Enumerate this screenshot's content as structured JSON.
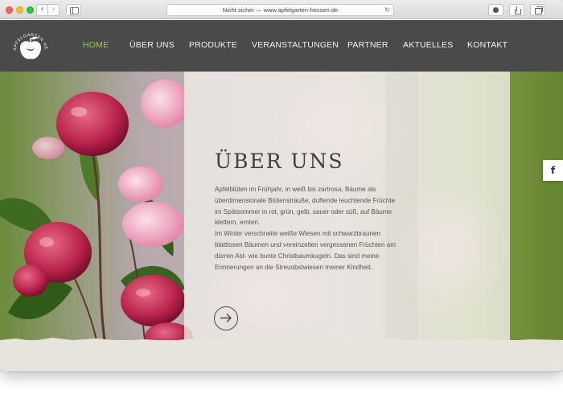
{
  "browser": {
    "address": "Nicht sicher — www.apfelgarten-hessen.de",
    "back_glyph": "‹",
    "forward_glyph": "›",
    "reload_glyph": "↻"
  },
  "site": {
    "logo_text": "APFELGARTEN HESSEN",
    "nav": [
      {
        "label": "HOME",
        "active": true
      },
      {
        "label": "ÜBER UNS",
        "active": false
      },
      {
        "label": "PRODUKTE",
        "active": false
      },
      {
        "label": "VERANSTALTUNGEN",
        "active": false
      },
      {
        "label": "PARTNER",
        "active": false
      },
      {
        "label": "AKTUELLES",
        "active": false
      },
      {
        "label": "KONTAKT",
        "active": false
      }
    ],
    "colors": {
      "header": "#4a4a4a",
      "active_nav": "#9dc05a",
      "panel": "#f0eee9"
    }
  },
  "hero": {
    "title": "ÜBER UNS",
    "paragraph1": "Apfelblüten im Frühjahr, in weiß bis zartrosa, Bäume als überdimensionale Blütensträuße, duftende leuchtende Früchte im Spätsommer in rot, grün, gelb, sauer oder süß, auf Bäume klettern, ernten.",
    "paragraph2": "Im Winter verschneite weiße Wiesen mit schwarzbraunen blattlosen Bäumen und vereinzelten vergessenen Früchten am dürren Ast- wie bunte Christbaumkugeln. Das sind meine Erinnerungen an die Streuobstwiesen meiner Kindheit.",
    "arrow_icon": "arrow-right-icon",
    "facebook_label": "f"
  }
}
